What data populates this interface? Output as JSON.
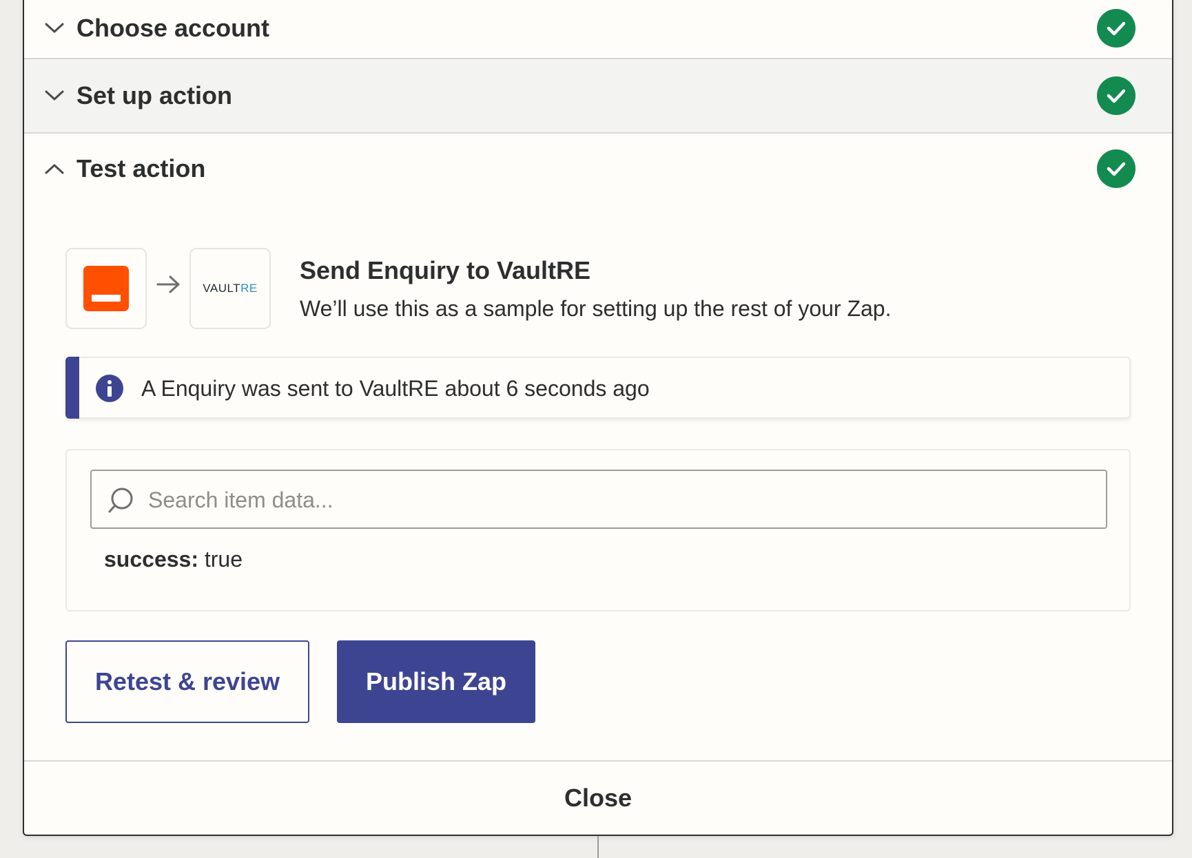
{
  "steps": [
    {
      "title": "Choose account",
      "state": "collapsed",
      "status": "complete"
    },
    {
      "title": "Set up action",
      "state": "collapsed",
      "status": "complete"
    },
    {
      "title": "Test action",
      "state": "expanded",
      "status": "complete"
    }
  ],
  "test": {
    "source_app_icon": "orange-app-icon",
    "arrow_icon": "arrow-right-icon",
    "target_app_logo": {
      "dark": "VAULT",
      "accent": "RE"
    },
    "title": "Send Enquiry to VaultRE",
    "subtitle": "We’ll use this as a sample for setting up the rest of your Zap.",
    "alert": {
      "icon": "info-icon",
      "text": "A Enquiry was sent to VaultRE about 6 seconds ago"
    },
    "search": {
      "placeholder": "Search item data...",
      "value": ""
    },
    "result": {
      "key": "success:",
      "value": "true"
    }
  },
  "buttons": {
    "retest": "Retest & review",
    "publish": "Publish Zap"
  },
  "footer": {
    "close": "Close"
  },
  "colors": {
    "accent": "#3d4592",
    "success": "#138a4f",
    "orange": "#ff4f00",
    "vault_blue": "#2a8fc6",
    "background": "#fffdf9"
  }
}
